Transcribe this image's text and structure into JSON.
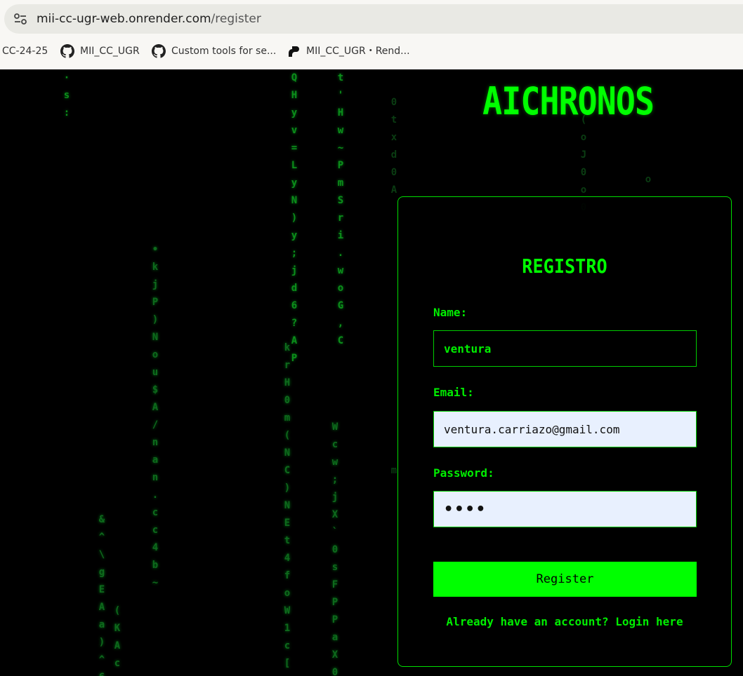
{
  "browser": {
    "url_host": "mii-cc-ugr-web.onrender.com",
    "url_path": "/register",
    "bookmarks": [
      {
        "label": "CC-24-25",
        "icon": "none"
      },
      {
        "label": "MII_CC_UGR",
        "icon": "github-icon"
      },
      {
        "label": "Custom tools for se...",
        "icon": "github-icon"
      },
      {
        "label": "MII_CC_UGR・Rend...",
        "icon": "render-icon"
      }
    ]
  },
  "app": {
    "brand": "AICHRONOS",
    "form": {
      "title": "REGISTRO",
      "name_label": "Name:",
      "name_value": "ventura",
      "email_label": "Email:",
      "email_value": "ventura.carriazo@gmail.com",
      "password_label": "Password:",
      "password_mask": "••••",
      "submit_label": "Register",
      "login_link": "Already have an account? Login here"
    }
  },
  "colors": {
    "accent": "#00ff00",
    "background": "#000000",
    "autofill_bg": "#e8f0fe"
  }
}
